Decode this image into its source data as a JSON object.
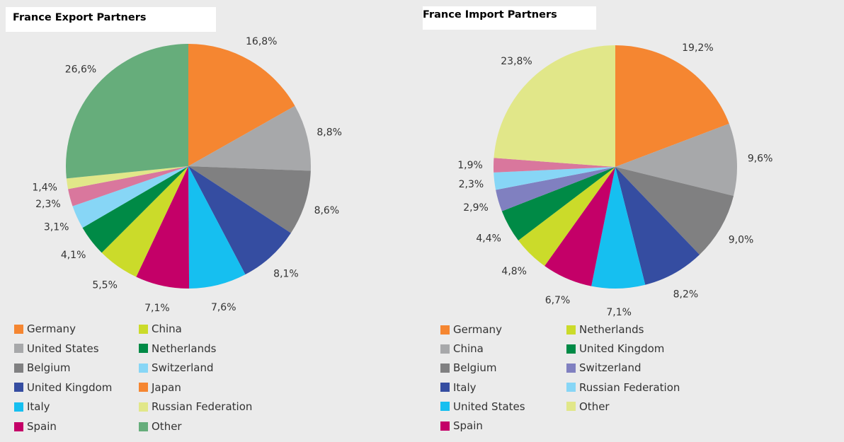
{
  "chart_data": [
    {
      "type": "pie",
      "title": "France Export Partners",
      "slices": [
        {
          "label": "Germany",
          "value": 16.8,
          "display": "16,8%",
          "color": "#f58631"
        },
        {
          "label": "United States",
          "value": 8.8,
          "display": "8,8%",
          "color": "#a7a8aa"
        },
        {
          "label": "Belgium",
          "value": 8.6,
          "display": "8,6%",
          "color": "#808081"
        },
        {
          "label": "United Kingdom",
          "value": 8.1,
          "display": "8,1%",
          "color": "#354da1"
        },
        {
          "label": "Italy",
          "value": 7.6,
          "display": "7,6%",
          "color": "#16bff0"
        },
        {
          "label": "Spain",
          "value": 7.1,
          "display": "7,1%",
          "color": "#c40068"
        },
        {
          "label": "China",
          "value": 5.5,
          "display": "5,5%",
          "color": "#cbdb2a"
        },
        {
          "label": "Netherlands",
          "value": 4.1,
          "display": "4,1%",
          "color": "#008a46"
        },
        {
          "label": "Switzerland",
          "value": 3.1,
          "display": "3,1%",
          "color": "#87d6f6"
        },
        {
          "label": "Japan",
          "value": 2.3,
          "display": "2,3%",
          "color": "#d9779d"
        },
        {
          "label": "Russian Federation",
          "value": 1.4,
          "display": "1,4%",
          "color": "#e1e789"
        },
        {
          "label": "Other",
          "value": 26.6,
          "display": "26,6%",
          "color": "#66ad7b"
        }
      ],
      "legend": [
        {
          "label": "Germany",
          "color": "#f58631"
        },
        {
          "label": "United States",
          "color": "#a7a8aa"
        },
        {
          "label": "Belgium",
          "color": "#808081"
        },
        {
          "label": "United Kingdom",
          "color": "#354da1"
        },
        {
          "label": "Italy",
          "color": "#16bff0"
        },
        {
          "label": "Spain",
          "color": "#c40068"
        },
        {
          "label": "China",
          "color": "#cbdb2a"
        },
        {
          "label": "Netherlands",
          "color": "#008a46"
        },
        {
          "label": "Switzerland",
          "color": "#87d6f6"
        },
        {
          "label": "Japan",
          "color": "#f58631"
        },
        {
          "label": "Russian Federation",
          "color": "#e1e789"
        },
        {
          "label": "Other",
          "color": "#66ad7b"
        }
      ],
      "legend_placement": "bottom"
    },
    {
      "type": "pie",
      "title": "France Import Partners",
      "slices": [
        {
          "label": "Germany",
          "value": 19.2,
          "display": "19,2%",
          "color": "#f58631"
        },
        {
          "label": "China",
          "value": 9.6,
          "display": "9,6%",
          "color": "#a7a8aa"
        },
        {
          "label": "Belgium",
          "value": 9.0,
          "display": "9,0%",
          "color": "#808081"
        },
        {
          "label": "Italy",
          "value": 8.2,
          "display": "8,2%",
          "color": "#354da1"
        },
        {
          "label": "United States",
          "value": 7.1,
          "display": "7,1%",
          "color": "#16bff0"
        },
        {
          "label": "Spain",
          "value": 6.7,
          "display": "6,7%",
          "color": "#c40068"
        },
        {
          "label": "Netherlands",
          "value": 4.8,
          "display": "4,8%",
          "color": "#cbdb2a"
        },
        {
          "label": "United Kingdom",
          "value": 4.4,
          "display": "4,4%",
          "color": "#008a46"
        },
        {
          "label": "Switzerland",
          "value": 2.9,
          "display": "2,9%",
          "color": "#8080c0"
        },
        {
          "label": "Russian Federation",
          "value": 2.3,
          "display": "2,3%",
          "color": "#87d6f6"
        },
        {
          "label": "",
          "value": 1.9,
          "display": "1,9%",
          "color": "#d9779d"
        },
        {
          "label": "Other",
          "value": 23.8,
          "display": "23,8%",
          "color": "#e1e789"
        }
      ],
      "legend": [
        {
          "label": "Germany",
          "color": "#f58631"
        },
        {
          "label": "China",
          "color": "#a7a8aa"
        },
        {
          "label": "Belgium",
          "color": "#808081"
        },
        {
          "label": "Italy",
          "color": "#354da1"
        },
        {
          "label": "United States",
          "color": "#16bff0"
        },
        {
          "label": "Spain",
          "color": "#c40068"
        },
        {
          "label": "Netherlands",
          "color": "#cbdb2a"
        },
        {
          "label": "United Kingdom",
          "color": "#008a46"
        },
        {
          "label": "Switzerland",
          "color": "#8080c0"
        },
        {
          "label": "Russian Federation",
          "color": "#87d6f6"
        },
        {
          "label": "Other",
          "color": "#e1e789"
        }
      ],
      "legend_placement": "bottom"
    }
  ]
}
